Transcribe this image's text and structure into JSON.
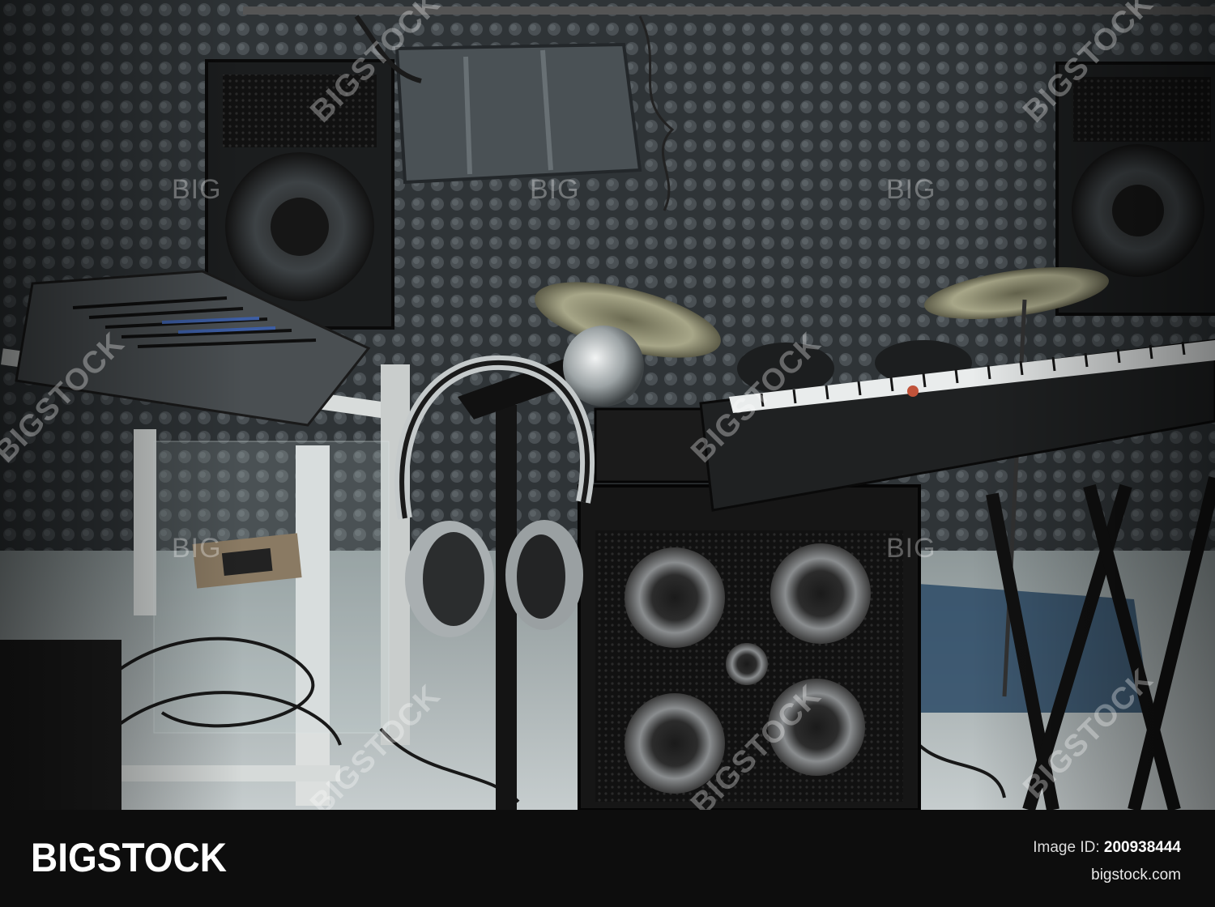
{
  "watermark": {
    "small": "BIG",
    "diagonal": "BIGSTOCK"
  },
  "footer": {
    "brand": "BIGSTOCK",
    "image_id_label": "Image ID:",
    "image_id": "200938444",
    "site": "bigstock.com"
  },
  "colors": {
    "footer_background": "#0d0d0d",
    "foam_wall": "#3a3f42",
    "floor": "#b9c1c2"
  }
}
